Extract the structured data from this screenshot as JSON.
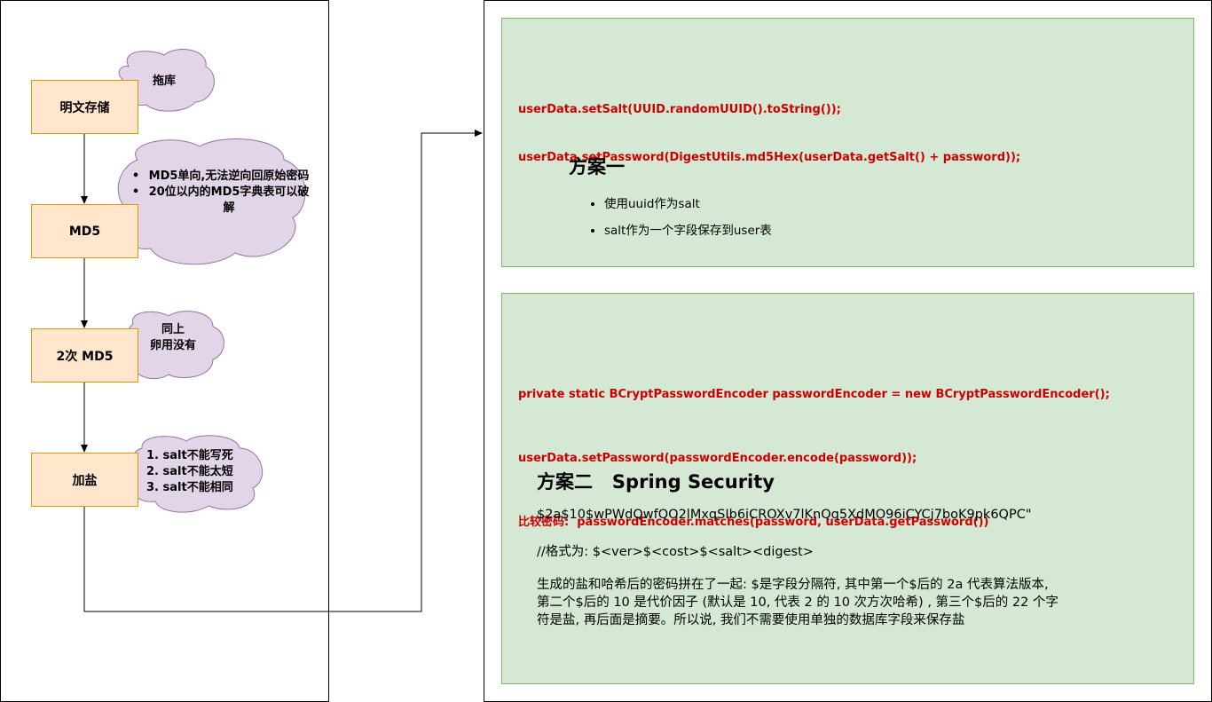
{
  "flow": {
    "steps": [
      "明文存储",
      "MD5",
      "2次 MD5",
      "加盐"
    ],
    "note_plaintext": "拖库",
    "note_md5": [
      "MD5单向,无法逆向回原始密码",
      "20位以内的MD5字典表可以破解"
    ],
    "note_double_md5": [
      "同上",
      "卵用没有"
    ],
    "note_salt": [
      "1. salt不能写死",
      "2. salt不能太短",
      "3. salt不能相同"
    ]
  },
  "scheme1": {
    "code": [
      "userData.setSalt(UUID.randomUUID().toString());",
      "userData.setPassword(DigestUtils.md5Hex(userData.getSalt() + password));"
    ],
    "title": "方案一",
    "bullets": [
      "使用uuid作为salt",
      "salt作为一个字段保存到user表"
    ]
  },
  "scheme2": {
    "code": [
      "private static BCryptPasswordEncoder passwordEncoder = new BCryptPasswordEncoder();",
      "userData.setPassword(passwordEncoder.encode(password));",
      "比较密码:  passwordEncoder.matches(password, userData.getPassword())"
    ],
    "title": "方案二   Spring Security",
    "hash": "$2a$10$wPWdQwfQO2lMxqSIb6iCROXv7lKnQq5XdMO96iCYCj7boK9pk6QPC\"",
    "format": "//格式为: $<ver>$<cost>$<salt><digest>",
    "description": [
      "生成的盐和哈希后的密码拼在了一起: $是字段分隔符, 其中第一个$后的 2a 代表算法版本,",
      "第二个$后的 10 是代价因子 (默认是 10, 代表 2 的 10 次方次哈希) , 第三个$后的 22 个字",
      "符是盐, 再后面是摘要。所以说, 我们不需要使用单独的数据库字段来保存盐"
    ]
  },
  "colors": {
    "step_fill": "#ffe6cc",
    "step_stroke": "#d79b00",
    "cloud_fill": "#e1d5e7",
    "cloud_stroke": "#9673a6",
    "panel_fill": "#d5e8d4",
    "panel_stroke": "#82b366",
    "code_color": "#cc0000"
  }
}
